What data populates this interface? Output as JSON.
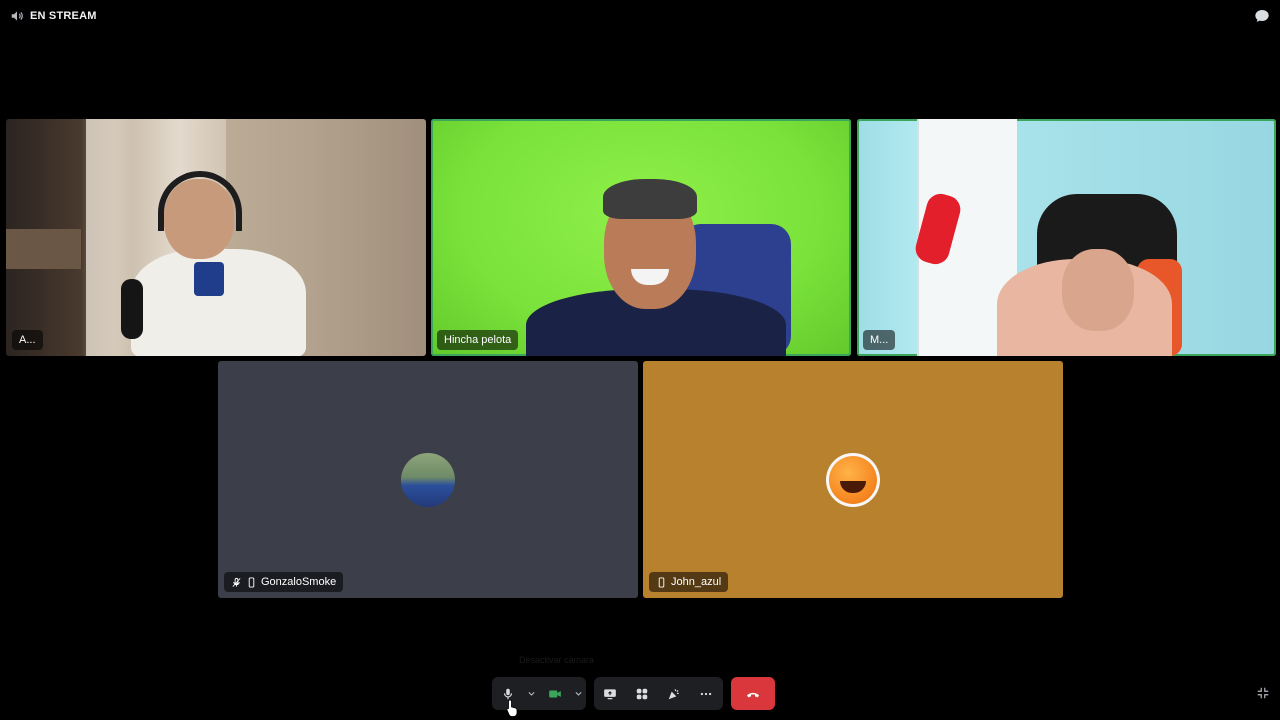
{
  "header": {
    "stream_label": "EN STREAM"
  },
  "participants": [
    {
      "name": "A...",
      "muted": false,
      "mobile": false,
      "speaking": false
    },
    {
      "name": "Hincha pelota",
      "muted": false,
      "mobile": false,
      "speaking": true
    },
    {
      "name": "M...",
      "muted": false,
      "mobile": false,
      "speaking": true
    },
    {
      "name": "GonzaloSmoke",
      "muted": true,
      "mobile": true,
      "speaking": false
    },
    {
      "name": "John_azul",
      "muted": false,
      "mobile": true,
      "speaking": false
    }
  ],
  "controls": {
    "hint": "Desactivar cámara",
    "icons": [
      "microphone-icon",
      "chevron-down-icon",
      "camera-icon",
      "share-screen-icon",
      "activities-icon",
      "soundboard-icon",
      "more-icon",
      "hang-up-icon",
      "exit-fullscreen-icon",
      "chat-icon",
      "speaker-icon"
    ]
  },
  "colors": {
    "hangup": "#da373c",
    "camera_on": "#3ba55c",
    "tile_dark": "#3c3f49",
    "tile_orange": "#b8812e"
  }
}
